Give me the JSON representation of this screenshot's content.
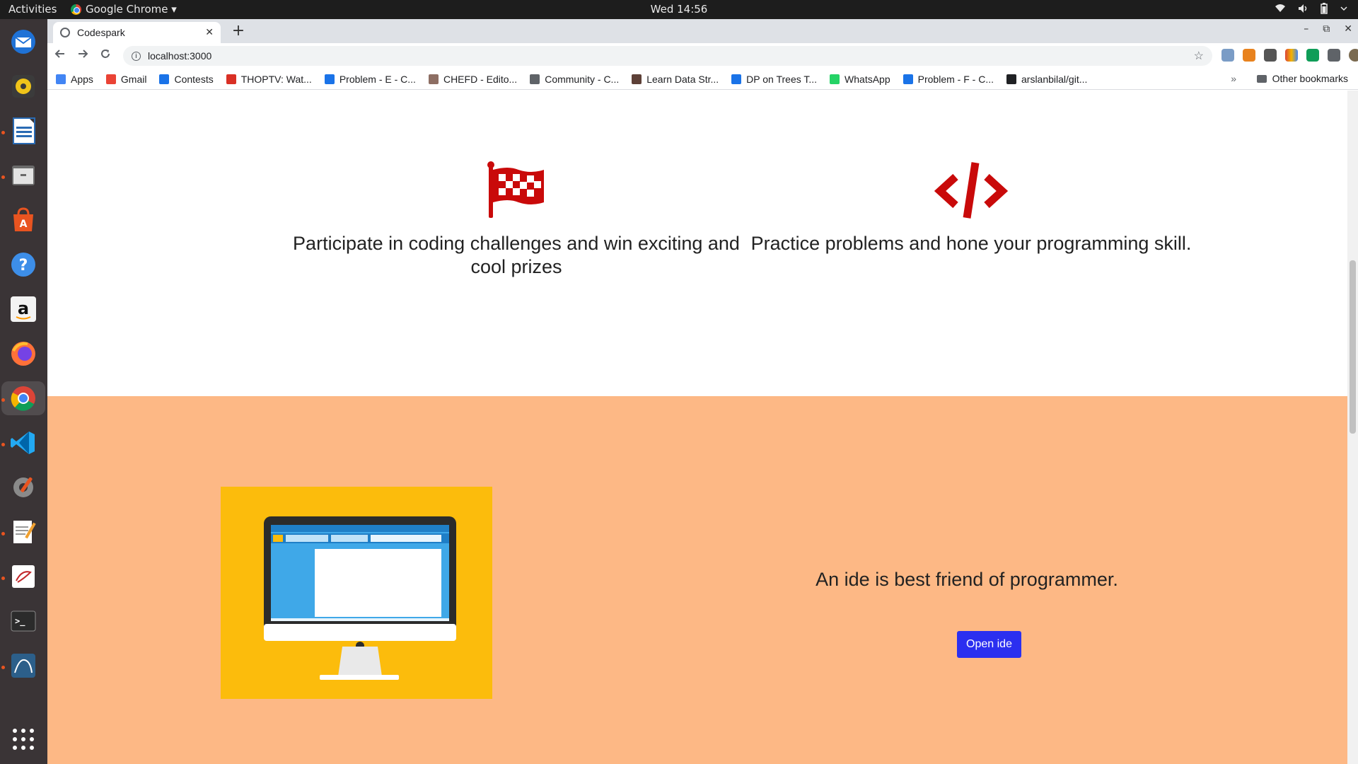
{
  "topbar": {
    "activities": "Activities",
    "app_name": "Google Chrome ▾",
    "clock": "Wed 14:56",
    "status_icons": [
      "wifi-icon",
      "volume-icon",
      "battery-icon",
      "power-menu-icon"
    ]
  },
  "dock": {
    "items": [
      "thunderbird-icon",
      "rhythmbox-icon",
      "writer-icon",
      "files-icon",
      "software-icon",
      "help-icon",
      "amazon-icon",
      "firefox-icon",
      "chrome-icon",
      "vscode-icon",
      "settings-icon",
      "text-editor-icon",
      "document-viewer-icon",
      "terminal-icon",
      "mysql-workbench-icon",
      "show-apps-icon"
    ],
    "amazon_glyph": "a",
    "help_glyph": "?",
    "terminal_glyph": ">_"
  },
  "browser": {
    "tab_title": "Codespark",
    "tab_close": "✕",
    "new_tab": "+",
    "url": "localhost:3000",
    "window_controls": [
      "–",
      "⧉",
      "✕"
    ],
    "bookmarks": [
      {
        "label": "Apps",
        "color": "#4285f4"
      },
      {
        "label": "Gmail",
        "color": "#ea4335"
      },
      {
        "label": "Contests",
        "color": "#1a73e8"
      },
      {
        "label": "THOPTV: Wat...",
        "color": "#d93025"
      },
      {
        "label": "Problem - E - C...",
        "color": "#1a73e8"
      },
      {
        "label": "CHEFD - Edito...",
        "color": "#8d6e63"
      },
      {
        "label": "Community - C...",
        "color": "#5f6368"
      },
      {
        "label": "Learn Data Str...",
        "color": "#5d4037"
      },
      {
        "label": "DP on Trees T...",
        "color": "#1a73e8"
      },
      {
        "label": "WhatsApp",
        "color": "#25d366"
      },
      {
        "label": "Problem - F - C...",
        "color": "#1a73e8"
      },
      {
        "label": "arslanbilal/git...",
        "color": "#202124"
      }
    ],
    "bookmarks_more": "»",
    "other_bookmarks": "Other bookmarks"
  },
  "page": {
    "feature_left_text": "Participate in coding challenges and win exciting and cool prizes",
    "feature_right_text": "Practice problems and hone your programming skill.",
    "ide_text": "An ide is best friend of programmer.",
    "open_ide_label": "Open ide",
    "accent_color": "#c90a0a",
    "section_bg": "#fdb885",
    "button_color": "#2b2ff0"
  }
}
